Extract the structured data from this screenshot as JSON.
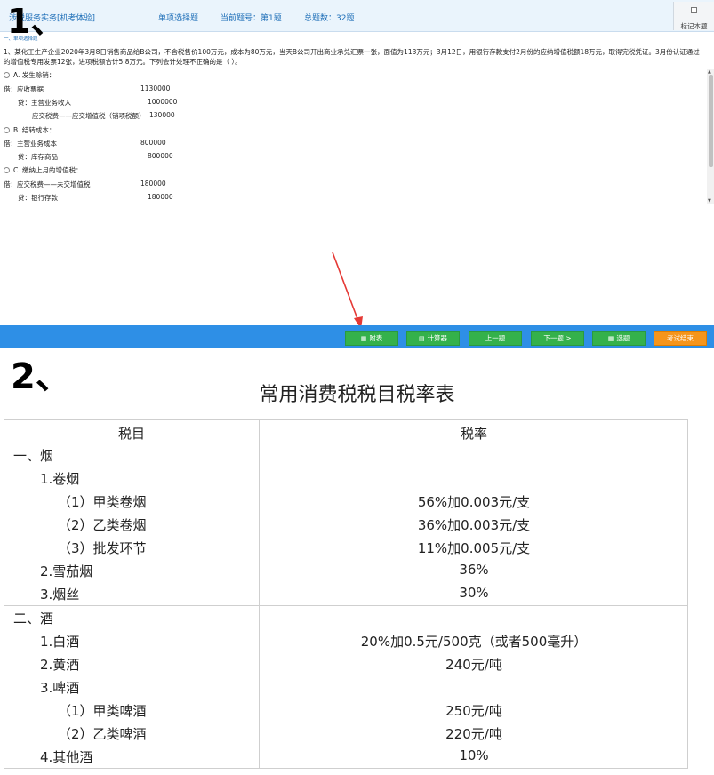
{
  "labels": {
    "part1": "1、",
    "part2": "2、"
  },
  "exam": {
    "header": {
      "course": "涉税服务实务[机考体验]",
      "type": "单项选择题",
      "current": "当前题号：第1题",
      "total": "总题数：32题",
      "mark_label": "标记本题"
    },
    "section_label": "一、单项选择题",
    "question": "1、某化工生产企业2020年3月8日销售商品给B公司，不含税售价100万元，成本为80万元，当天B公司开出商业承兑汇票一张，面值为113万元；3月12日，用银行存款支付2月份的应纳增值税额18万元，取得完税凭证。3月份认证通过的增值税专用发票12张，进项税额合计5.8万元。下列会计处理不正确的是（   ）。",
    "options": [
      {
        "label": "A. 发生赊销：",
        "lines": [
          {
            "text": "借：应收票据",
            "amount": "1130000"
          },
          {
            "text": "贷：主营业务收入",
            "amount": "1000000"
          },
          {
            "text": "应交税费——应交增值税（销项税额）",
            "amount": "130000"
          }
        ]
      },
      {
        "label": "B. 结转成本：",
        "lines": [
          {
            "text": "借：主营业务成本",
            "amount": "800000"
          },
          {
            "text": "贷：库存商品",
            "amount": "800000"
          }
        ]
      },
      {
        "label": "C. 缴纳上月的增值税：",
        "lines": [
          {
            "text": "借：应交税费——未交增值税",
            "amount": "180000"
          },
          {
            "text": "贷：银行存款",
            "amount": "180000"
          }
        ]
      }
    ],
    "buttons": {
      "attach": "附表",
      "calc": "计算器",
      "prev": "上一题",
      "next": "下一题 >",
      "select": "选题",
      "finish": "考试结束"
    },
    "accent_colors": {
      "bar": "#2e8fe6",
      "button": "#34b14b",
      "finish": "#f5951c",
      "arrow": "#e53935"
    }
  },
  "rate_table": {
    "title": "常用消费税税目税率表",
    "headers": {
      "item": "税目",
      "rate": "税率"
    },
    "groups": [
      {
        "rows": [
          {
            "item": "一、烟",
            "rate": ""
          },
          {
            "item": "1.卷烟",
            "rate": ""
          },
          {
            "item": "（1）甲类卷烟",
            "rate": "56%加0.003元/支"
          },
          {
            "item": "（2）乙类卷烟",
            "rate": "36%加0.003元/支"
          },
          {
            "item": "（3）批发环节",
            "rate": "11%加0.005元/支"
          },
          {
            "item": "2.雪茄烟",
            "rate": "36%"
          },
          {
            "item": "3.烟丝",
            "rate": "30%"
          }
        ]
      },
      {
        "rows": [
          {
            "item": "二、酒",
            "rate": ""
          },
          {
            "item": "1.白酒",
            "rate": "20%加0.5元/500克（或者500毫升）"
          },
          {
            "item": "2.黄酒",
            "rate": "240元/吨"
          },
          {
            "item": "3.啤酒",
            "rate": ""
          },
          {
            "item": "（1）甲类啤酒",
            "rate": "250元/吨"
          },
          {
            "item": "（2）乙类啤酒",
            "rate": "220元/吨"
          },
          {
            "item": "4.其他酒",
            "rate": "10%"
          }
        ]
      }
    ]
  }
}
